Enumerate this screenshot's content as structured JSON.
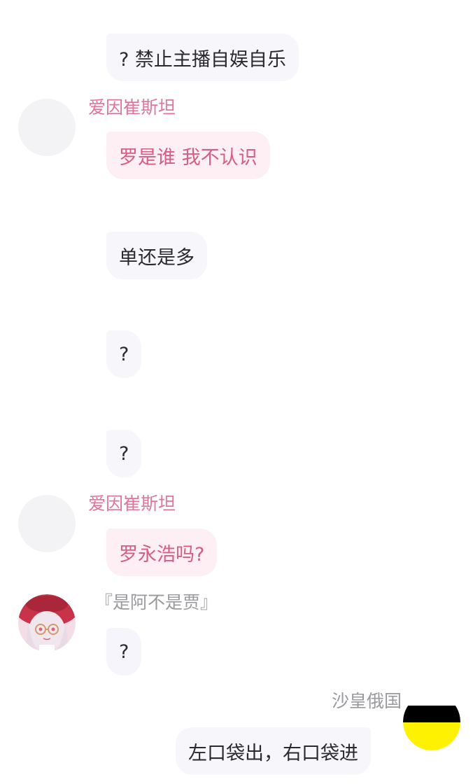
{
  "messages": [
    {
      "text": "? 禁止主播自娱自乐"
    },
    {
      "sender": "爱因崔斯坦",
      "text": "罗是谁 我不认识"
    },
    {
      "text": "单还是多"
    },
    {
      "text": "?"
    },
    {
      "text": "?"
    },
    {
      "sender": "爱因崔斯坦",
      "text": "罗永浩吗?"
    },
    {
      "sender": "『是阿不是贾』",
      "text": "?"
    },
    {
      "sender": "沙皇俄国",
      "text": "左口袋出，右口袋进"
    }
  ],
  "colors": {
    "name_pink": "#e07599",
    "bubble_pink": "#fdeff4",
    "bubble_gray": "#f6f6fb",
    "flag_black": "#000000",
    "flag_yellow": "#fff200"
  },
  "icons": {
    "flag_avatar": "black-yellow-flag-icon",
    "anime_avatar": "anime-girl-avatar"
  }
}
